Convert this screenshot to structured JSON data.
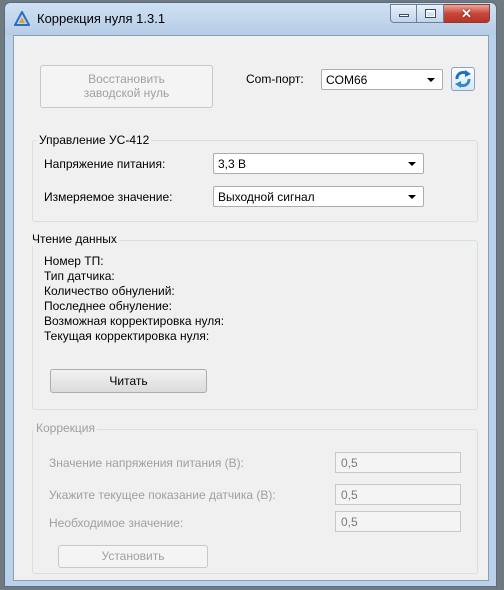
{
  "window": {
    "title": "Коррекция нуля 1.3.1"
  },
  "top": {
    "restore_button": "Восстановить\nзаводской нуль",
    "restore_line1": "Восстановить",
    "restore_line2": "заводской нуль",
    "port_label": "Com-порт:",
    "port_value": "COM66"
  },
  "control": {
    "title": "Управление УС-412",
    "voltage_label": "Напряжение питания:",
    "voltage_value": "3,3 В",
    "measure_label": "Измеряемое значение:",
    "measure_value": "Выходной сигнал"
  },
  "reading": {
    "title": "Чтение данных",
    "fields": [
      "Номер ТП:",
      "Тип датчика:",
      "Количество обнулений:",
      "Последнее обнуление:",
      "Возможная корректировка нуля:",
      "Текущая корректировка нуля:"
    ],
    "read_button": "Читать"
  },
  "correction": {
    "title": "Коррекция",
    "rows": [
      {
        "label": "Значение напряжения питания (В):",
        "value": "0,5"
      },
      {
        "label": "Укажите текущее показание датчика (В):",
        "value": "0,5"
      },
      {
        "label": "Необходимое значение:",
        "value": "0,5"
      }
    ],
    "set_button": "Установить"
  },
  "colors": {
    "titlebar": "#b9d1ea",
    "client": "#f0f0f0",
    "close": "#c8473a",
    "disabled_text": "#a0a0a0"
  },
  "icons": {
    "app": "triangle-logo-icon",
    "refresh": "refresh-icon",
    "dropdown": "chevron-down-icon"
  }
}
